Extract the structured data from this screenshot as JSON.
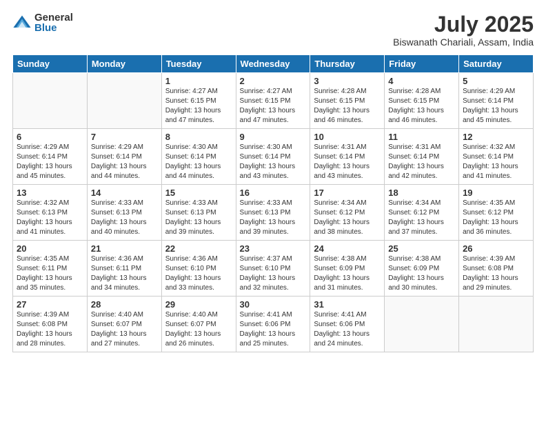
{
  "logo": {
    "general": "General",
    "blue": "Blue"
  },
  "title": "July 2025",
  "location": "Biswanath Chariali, Assam, India",
  "days_of_week": [
    "Sunday",
    "Monday",
    "Tuesday",
    "Wednesday",
    "Thursday",
    "Friday",
    "Saturday"
  ],
  "weeks": [
    [
      {
        "day": "",
        "info": ""
      },
      {
        "day": "",
        "info": ""
      },
      {
        "day": "1",
        "info": "Sunrise: 4:27 AM\nSunset: 6:15 PM\nDaylight: 13 hours and 47 minutes."
      },
      {
        "day": "2",
        "info": "Sunrise: 4:27 AM\nSunset: 6:15 PM\nDaylight: 13 hours and 47 minutes."
      },
      {
        "day": "3",
        "info": "Sunrise: 4:28 AM\nSunset: 6:15 PM\nDaylight: 13 hours and 46 minutes."
      },
      {
        "day": "4",
        "info": "Sunrise: 4:28 AM\nSunset: 6:15 PM\nDaylight: 13 hours and 46 minutes."
      },
      {
        "day": "5",
        "info": "Sunrise: 4:29 AM\nSunset: 6:14 PM\nDaylight: 13 hours and 45 minutes."
      }
    ],
    [
      {
        "day": "6",
        "info": "Sunrise: 4:29 AM\nSunset: 6:14 PM\nDaylight: 13 hours and 45 minutes."
      },
      {
        "day": "7",
        "info": "Sunrise: 4:29 AM\nSunset: 6:14 PM\nDaylight: 13 hours and 44 minutes."
      },
      {
        "day": "8",
        "info": "Sunrise: 4:30 AM\nSunset: 6:14 PM\nDaylight: 13 hours and 44 minutes."
      },
      {
        "day": "9",
        "info": "Sunrise: 4:30 AM\nSunset: 6:14 PM\nDaylight: 13 hours and 43 minutes."
      },
      {
        "day": "10",
        "info": "Sunrise: 4:31 AM\nSunset: 6:14 PM\nDaylight: 13 hours and 43 minutes."
      },
      {
        "day": "11",
        "info": "Sunrise: 4:31 AM\nSunset: 6:14 PM\nDaylight: 13 hours and 42 minutes."
      },
      {
        "day": "12",
        "info": "Sunrise: 4:32 AM\nSunset: 6:14 PM\nDaylight: 13 hours and 41 minutes."
      }
    ],
    [
      {
        "day": "13",
        "info": "Sunrise: 4:32 AM\nSunset: 6:13 PM\nDaylight: 13 hours and 41 minutes."
      },
      {
        "day": "14",
        "info": "Sunrise: 4:33 AM\nSunset: 6:13 PM\nDaylight: 13 hours and 40 minutes."
      },
      {
        "day": "15",
        "info": "Sunrise: 4:33 AM\nSunset: 6:13 PM\nDaylight: 13 hours and 39 minutes."
      },
      {
        "day": "16",
        "info": "Sunrise: 4:33 AM\nSunset: 6:13 PM\nDaylight: 13 hours and 39 minutes."
      },
      {
        "day": "17",
        "info": "Sunrise: 4:34 AM\nSunset: 6:12 PM\nDaylight: 13 hours and 38 minutes."
      },
      {
        "day": "18",
        "info": "Sunrise: 4:34 AM\nSunset: 6:12 PM\nDaylight: 13 hours and 37 minutes."
      },
      {
        "day": "19",
        "info": "Sunrise: 4:35 AM\nSunset: 6:12 PM\nDaylight: 13 hours and 36 minutes."
      }
    ],
    [
      {
        "day": "20",
        "info": "Sunrise: 4:35 AM\nSunset: 6:11 PM\nDaylight: 13 hours and 35 minutes."
      },
      {
        "day": "21",
        "info": "Sunrise: 4:36 AM\nSunset: 6:11 PM\nDaylight: 13 hours and 34 minutes."
      },
      {
        "day": "22",
        "info": "Sunrise: 4:36 AM\nSunset: 6:10 PM\nDaylight: 13 hours and 33 minutes."
      },
      {
        "day": "23",
        "info": "Sunrise: 4:37 AM\nSunset: 6:10 PM\nDaylight: 13 hours and 32 minutes."
      },
      {
        "day": "24",
        "info": "Sunrise: 4:38 AM\nSunset: 6:09 PM\nDaylight: 13 hours and 31 minutes."
      },
      {
        "day": "25",
        "info": "Sunrise: 4:38 AM\nSunset: 6:09 PM\nDaylight: 13 hours and 30 minutes."
      },
      {
        "day": "26",
        "info": "Sunrise: 4:39 AM\nSunset: 6:08 PM\nDaylight: 13 hours and 29 minutes."
      }
    ],
    [
      {
        "day": "27",
        "info": "Sunrise: 4:39 AM\nSunset: 6:08 PM\nDaylight: 13 hours and 28 minutes."
      },
      {
        "day": "28",
        "info": "Sunrise: 4:40 AM\nSunset: 6:07 PM\nDaylight: 13 hours and 27 minutes."
      },
      {
        "day": "29",
        "info": "Sunrise: 4:40 AM\nSunset: 6:07 PM\nDaylight: 13 hours and 26 minutes."
      },
      {
        "day": "30",
        "info": "Sunrise: 4:41 AM\nSunset: 6:06 PM\nDaylight: 13 hours and 25 minutes."
      },
      {
        "day": "31",
        "info": "Sunrise: 4:41 AM\nSunset: 6:06 PM\nDaylight: 13 hours and 24 minutes."
      },
      {
        "day": "",
        "info": ""
      },
      {
        "day": "",
        "info": ""
      }
    ]
  ]
}
